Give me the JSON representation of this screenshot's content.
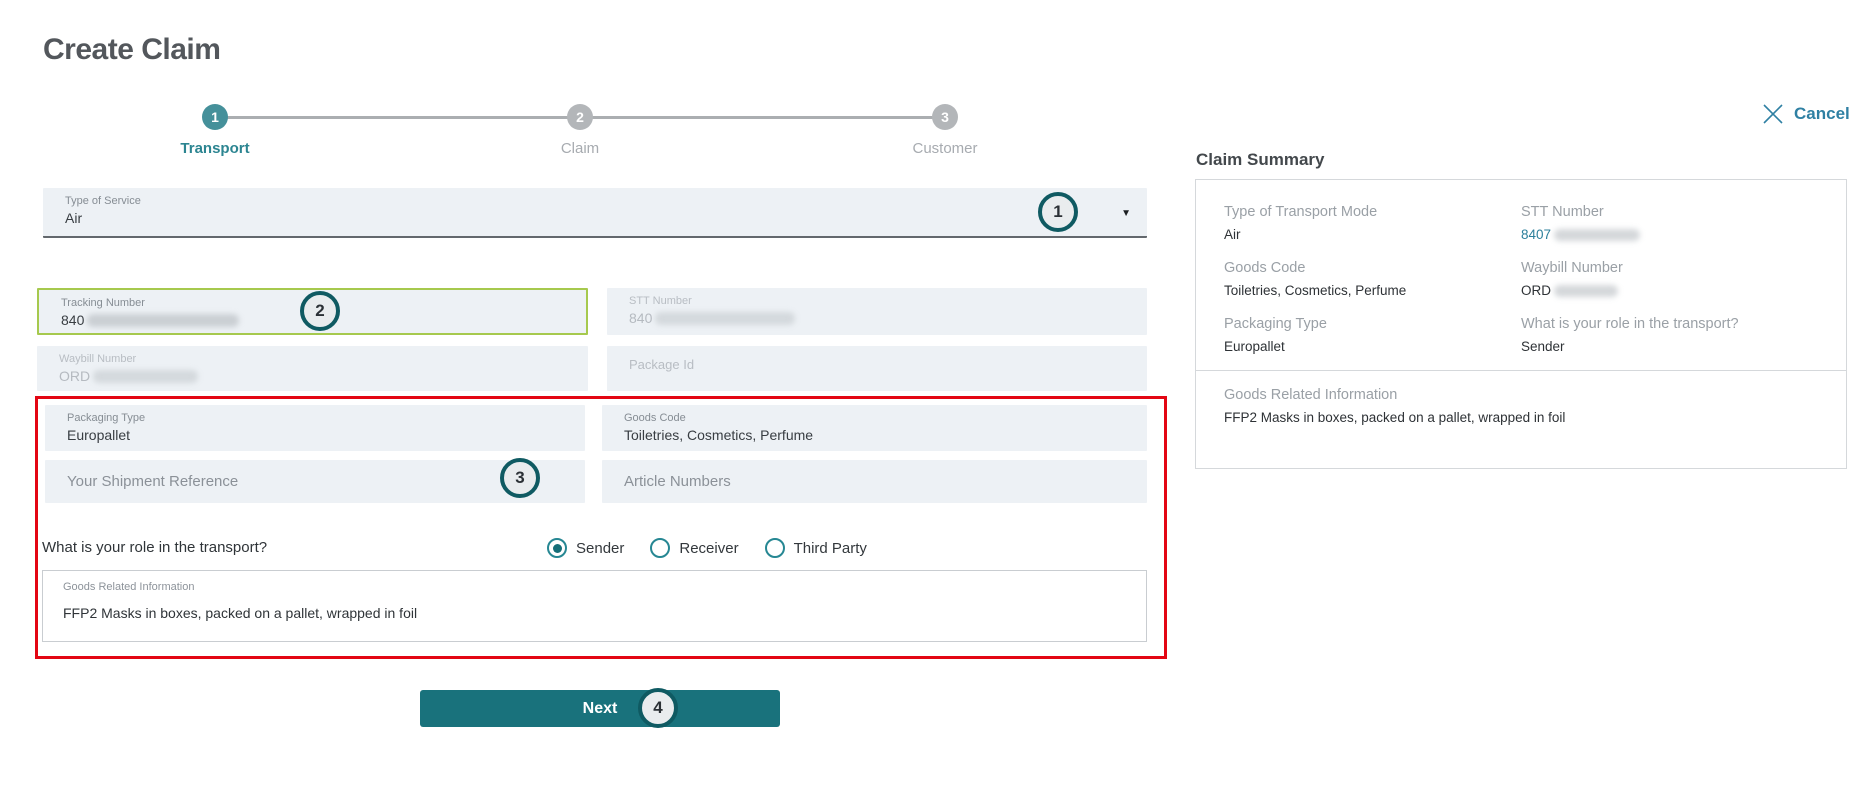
{
  "page": {
    "title": "Create Claim"
  },
  "stepper": {
    "steps": [
      {
        "num": "1",
        "label": "Transport",
        "state": "active"
      },
      {
        "num": "2",
        "label": "Claim",
        "state": "upcoming"
      },
      {
        "num": "3",
        "label": "Customer",
        "state": "upcoming"
      }
    ]
  },
  "cancel": {
    "label": "Cancel",
    "icon": "close-icon"
  },
  "icons": {
    "dropdown_caret": "▼"
  },
  "form": {
    "type_of_service": {
      "label": "Type of Service",
      "value": "Air"
    },
    "tracking_number": {
      "label": "Tracking Number",
      "value_prefix": "840",
      "redacted": true
    },
    "stt_number": {
      "label": "STT Number",
      "value_prefix": "840",
      "redacted": true,
      "disabled": true
    },
    "waybill_number": {
      "label": "Waybill Number",
      "value_prefix": "ORD",
      "redacted": true,
      "disabled": true
    },
    "package_id": {
      "label": "Package Id",
      "value": "",
      "disabled": true
    },
    "packaging_type": {
      "label": "Packaging Type",
      "value": "Europallet"
    },
    "goods_code": {
      "label": "Goods Code",
      "value": "Toiletries, Cosmetics, Perfume"
    },
    "shipment_reference": {
      "placeholder": "Your Shipment Reference"
    },
    "article_numbers": {
      "placeholder": "Article Numbers"
    },
    "role_question": "What is your role in the transport?",
    "role_options": [
      {
        "label": "Sender",
        "selected": true
      },
      {
        "label": "Receiver",
        "selected": false
      },
      {
        "label": "Third Party",
        "selected": false
      }
    ],
    "goods_related_info": {
      "label": "Goods Related Information",
      "value": "FFP2 Masks in boxes, packed on a pallet, wrapped in foil"
    },
    "next_label": "Next"
  },
  "summary": {
    "title": "Claim Summary",
    "fields": [
      {
        "label": "Type of Transport Mode",
        "value": "Air"
      },
      {
        "label": "STT Number",
        "value_prefix": "8407",
        "redacted": true
      },
      {
        "label": "Goods Code",
        "value": "Toiletries, Cosmetics, Perfume"
      },
      {
        "label": "Waybill Number",
        "value_prefix": "ORD",
        "redacted": true
      },
      {
        "label": "Packaging Type",
        "value": "Europallet"
      },
      {
        "label": "What is your role in the transport?",
        "value": "Sender"
      },
      {
        "label": "Goods Related Information",
        "value": "FFP2 Masks in boxes, packed on a pallet, wrapped in foil"
      }
    ]
  },
  "annotations": {
    "markers": [
      "1",
      "2",
      "3",
      "4"
    ]
  },
  "colors": {
    "accent_teal": "#19727c",
    "step_active_teal": "#45909a",
    "link_blue": "#2f80a3",
    "valid_green": "#a6c94e",
    "highlight_red": "#e30613",
    "field_bg": "#edf1f5",
    "annotation_ring": "#0f5a62"
  }
}
